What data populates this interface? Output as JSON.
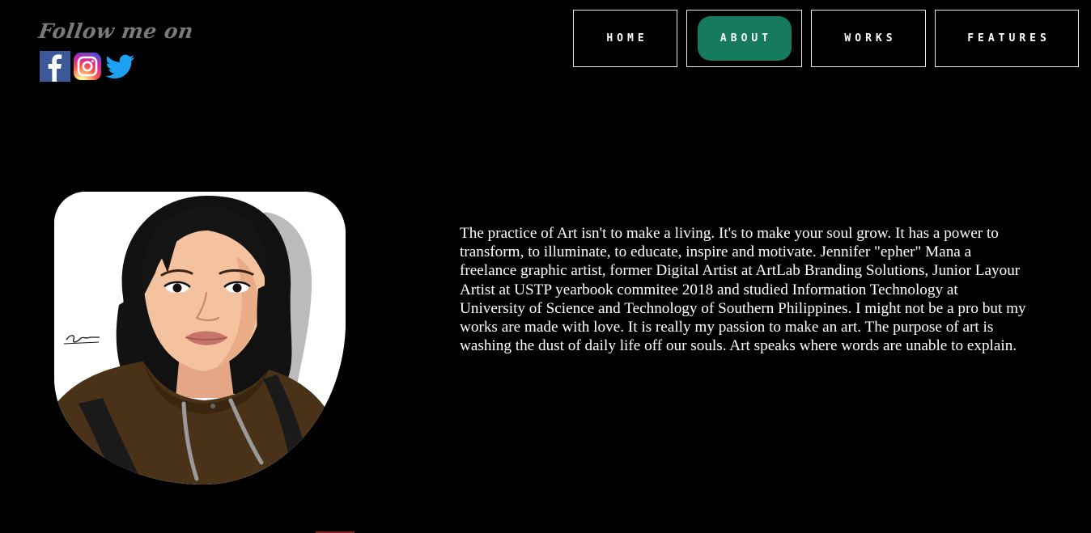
{
  "social": {
    "follow_label": "Follow me on",
    "icons": [
      {
        "name": "facebook-icon",
        "color": "#3b5998"
      },
      {
        "name": "instagram-icon",
        "color": "#d6249f"
      },
      {
        "name": "twitter-icon",
        "color": "#1da1f2"
      }
    ]
  },
  "nav": {
    "items": [
      {
        "label": "HOME",
        "active": false
      },
      {
        "label": "ABOUT",
        "active": true
      },
      {
        "label": "WORKS",
        "active": false
      },
      {
        "label": "FEATURES",
        "active": false
      }
    ],
    "active_color": "#167a5f"
  },
  "about": {
    "bio": "The practice of Art isn't to make a living. It's to make your soul grow. It has a power to transform, to illuminate, to educate, inspire and motivate. Jennifer \"epher\" Mana a freelance graphic artist, former Digital Artist at ArtLab Branding Solutions, Junior Layour Artist at USTP yearbook commitee 2018 and studied Information Technology at University of Science and Technology of Southern Philippines. I might not be a pro but my works are made with love. It is really my passion to make an art. The purpose of art is washing the dust of daily life off our souls. Art speaks where words are unable to explain."
  }
}
